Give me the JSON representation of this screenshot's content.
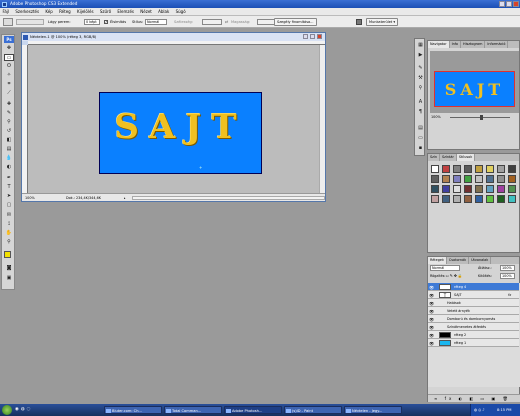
{
  "app": {
    "title": "Adobe Photoshop CS3 Extended"
  },
  "menu": [
    "Fájl",
    "Szerkesztés",
    "Kép",
    "Réteg",
    "Kijelölés",
    "Szűrő",
    "Elemzés",
    "Nézet",
    "Ablak",
    "Súgó"
  ],
  "options": {
    "feather_label": "Lágy perem:",
    "feather_value": "0 képt",
    "antialias_label": "Élsimítás",
    "style_label": "Stílus:",
    "style_value": "Normál",
    "width_label": "Szélesség:",
    "height_label": "Magasság:",
    "refine_button": "Szegély finomítása...",
    "workspace_button": "Munkaterület"
  },
  "document": {
    "title": "Névtelen-1 @ 100% (réteg 3, RGB/8)",
    "canvas_text": "SAJT",
    "zoom": "100%",
    "doc_info": "Dok.: 234,4K/344,6K"
  },
  "navigator": {
    "tabs": [
      "Navigator",
      "Info",
      "Hisztogram",
      "Információ"
    ],
    "zoom": "100%"
  },
  "styles_panel": {
    "tabs": [
      "Szín",
      "Színtár",
      "Stílusok"
    ],
    "swatches": [
      "#ffffff",
      "#c04040",
      "#808080",
      "#5a5a5a",
      "#c0a040",
      "#e0d060",
      "#a0a0a0",
      "#404040",
      "#606060",
      "#b08050",
      "#8080c0",
      "#40a040",
      "#c0c0c0",
      "#507090",
      "#909090",
      "#a06020",
      "#305060",
      "#4040a0",
      "#e0e0e0",
      "#703030",
      "#807050",
      "#60a0c0",
      "#a040a0",
      "#509050",
      "#c0a0a0",
      "#406080",
      "#b0b0b0",
      "#906040",
      "#3060a0",
      "#60c040",
      "#206020",
      "#40c0c0"
    ]
  },
  "layers_panel": {
    "tabs": [
      "Rétegek",
      "Csatornák",
      "Útvonalak"
    ],
    "blend_mode": "Normál",
    "opacity_label": "Átlátsz.:",
    "opacity_value": "100%",
    "lock_label": "Rögzítés:",
    "fill_label": "Kitöltés:",
    "fill_value": "100%",
    "layers": [
      {
        "name": "réteg 4",
        "selected": true,
        "thumb": "#ffffff"
      },
      {
        "name": "SAJT",
        "selected": false,
        "thumb": "#ffffff",
        "type_layer": true,
        "fx": "fx"
      },
      {
        "name": "Hatások",
        "selected": false,
        "effect": true
      },
      {
        "name": "Vetett árnyék",
        "selected": false,
        "effect": true
      },
      {
        "name": "Domború és dombornyomás",
        "selected": false,
        "effect": true
      },
      {
        "name": "Színátmenetes átfedés",
        "selected": false,
        "effect": true
      },
      {
        "name": "réteg 2",
        "selected": false,
        "thumb": "#000000"
      },
      {
        "name": "réteg 1",
        "selected": false,
        "thumb": "#19b6ef"
      }
    ]
  },
  "taskbar": {
    "tasks": [
      "Bluter.com: Ch...",
      "Total Comman...",
      "Adobe Photosh...",
      "(s)ID - Paint",
      "Névtelen - Jegy..."
    ],
    "active_task": 2,
    "clock": "8:15 PM"
  },
  "colors": {
    "canvas_bg": "#0a80ff",
    "text_gold": "#f0c020"
  }
}
